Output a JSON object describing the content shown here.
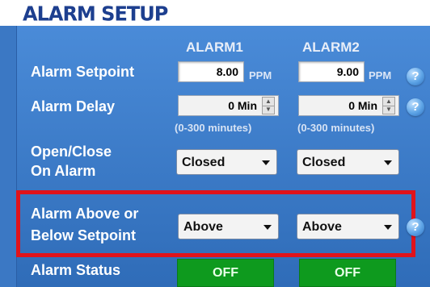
{
  "title": "ALARM SETUP",
  "columns": {
    "alarm1": "ALARM1",
    "alarm2": "ALARM2"
  },
  "rows": {
    "setpoint_label": "Alarm Setpoint",
    "delay_label": "Alarm Delay",
    "open_close_label_line1": "Open/Close",
    "open_close_label_line2": "On Alarm",
    "above_below_label_line1": "Alarm Above or",
    "above_below_label_line2": "Below Setpoint",
    "status_label": "Alarm Status"
  },
  "alarm1": {
    "setpoint": "8.00",
    "setpoint_unit": "PPM",
    "delay": "0 Min",
    "delay_range": "(0-300 minutes)",
    "open_close": "Closed",
    "above_below": "Above",
    "status": "OFF"
  },
  "alarm2": {
    "setpoint": "9.00",
    "setpoint_unit": "PPM",
    "delay": "0 Min",
    "delay_range": "(0-300 minutes)",
    "open_close": "Closed",
    "above_below": "Above",
    "status": "OFF"
  },
  "help_glyph": "?",
  "colors": {
    "panel": "#3b78c4",
    "title": "#1d3f8f",
    "highlight": "#e0131b",
    "status_off": "#0e9a1e"
  }
}
